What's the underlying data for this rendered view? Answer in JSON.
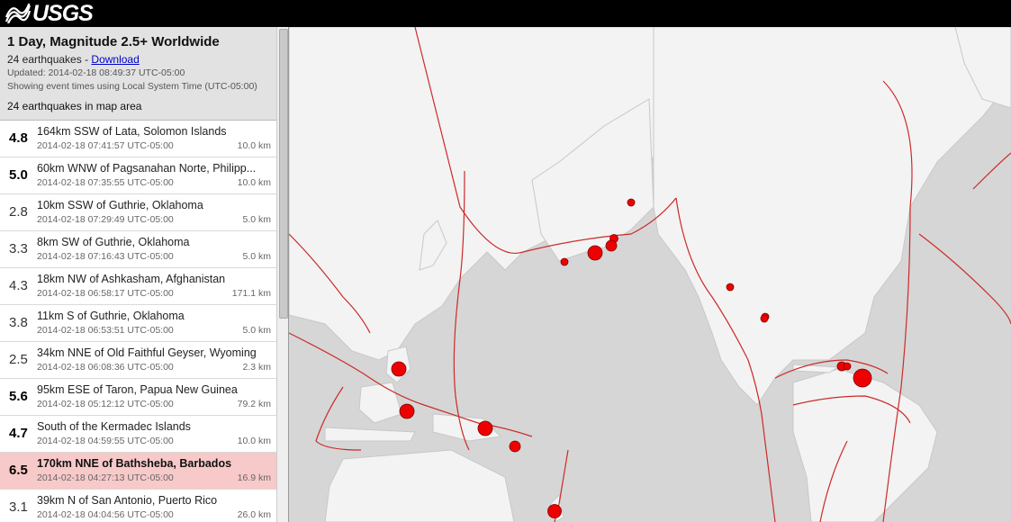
{
  "brand": {
    "name": "USGS"
  },
  "summary": {
    "title": "1 Day, Magnitude 2.5+ Worldwide",
    "count_text": "24 earthquakes - ",
    "download_label": "Download",
    "updated": "Updated: 2014-02-18 08:49:37 UTC-05:00",
    "timezone_note": "Showing event times using Local System Time (UTC-05:00)",
    "in_map_area": "24 earthquakes in map area"
  },
  "events": [
    {
      "mag": "4.8",
      "place": "164km SSW of Lata, Solomon Islands",
      "time": "2014-02-18 07:41:57 UTC-05:00",
      "depth": "10.0 km"
    },
    {
      "mag": "5.0",
      "place": "60km WNW of Pagsanahan Norte, Philipp...",
      "time": "2014-02-18 07:35:55 UTC-05:00",
      "depth": "10.0 km"
    },
    {
      "mag": "2.8",
      "place": "10km SSW of Guthrie, Oklahoma",
      "time": "2014-02-18 07:29:49 UTC-05:00",
      "depth": "5.0 km"
    },
    {
      "mag": "3.3",
      "place": "8km SW of Guthrie, Oklahoma",
      "time": "2014-02-18 07:16:43 UTC-05:00",
      "depth": "5.0 km"
    },
    {
      "mag": "4.3",
      "place": "18km NW of Ashkasham, Afghanistan",
      "time": "2014-02-18 06:58:17 UTC-05:00",
      "depth": "171.1 km"
    },
    {
      "mag": "3.8",
      "place": "11km S of Guthrie, Oklahoma",
      "time": "2014-02-18 06:53:51 UTC-05:00",
      "depth": "5.0 km"
    },
    {
      "mag": "2.5",
      "place": "34km NNE of Old Faithful Geyser, Wyoming",
      "time": "2014-02-18 06:08:36 UTC-05:00",
      "depth": "2.3 km"
    },
    {
      "mag": "5.6",
      "place": "95km ESE of Taron, Papua New Guinea",
      "time": "2014-02-18 05:12:12 UTC-05:00",
      "depth": "79.2 km"
    },
    {
      "mag": "4.7",
      "place": "South of the Kermadec Islands",
      "time": "2014-02-18 04:59:55 UTC-05:00",
      "depth": "10.0 km"
    },
    {
      "mag": "6.5",
      "place": "170km NNE of Bathsheba, Barbados",
      "time": "2014-02-18 04:27:13 UTC-05:00",
      "depth": "16.9 km"
    },
    {
      "mag": "3.1",
      "place": "39km N of San Antonio, Puerto Rico",
      "time": "2014-02-18 04:04:56 UTC-05:00",
      "depth": "26.0 km"
    }
  ],
  "colors": {
    "marker": "#ee0000",
    "plate_boundary": "#cc2a2a",
    "land": "#f3f3f3",
    "ocean": "#d6d6d6",
    "selected_row": "#f8c9c9"
  },
  "icons": {
    "logo": "usgs-wave-logo-icon"
  }
}
